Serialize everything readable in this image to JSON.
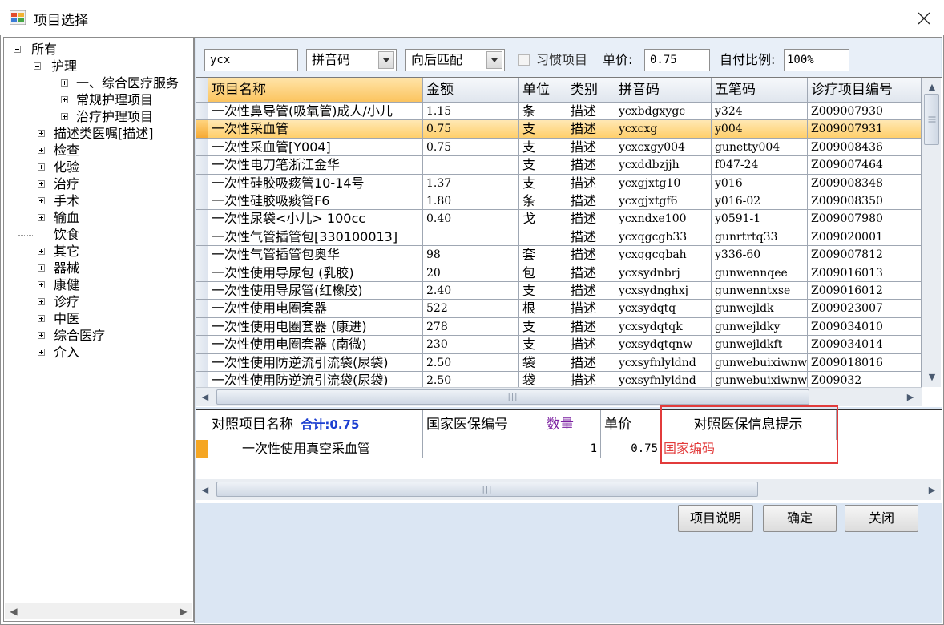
{
  "window": {
    "title": "项目选择",
    "close_glyph": "✕"
  },
  "tree": {
    "root": "所有",
    "nursing": "护理",
    "nursing_children": [
      "一、综合医疗服务",
      "常规护理项目",
      "治疗护理项目"
    ],
    "categories": [
      "描述类医嘱[描述]",
      "检查",
      "化验",
      "治疗",
      "手术",
      "输血",
      "饮食",
      "其它",
      "器械",
      "康健",
      "诊疗",
      "中医",
      "综合医疗",
      "介入"
    ]
  },
  "search": {
    "query": "ycx",
    "mode": "拼音码",
    "match": "向后匹配",
    "habit_label": "习惯项目",
    "habit_checked": false,
    "price_label": "单价:",
    "price_value": "0.75",
    "ratio_label": "自付比例:",
    "ratio_value": "100%"
  },
  "grid": {
    "columns": [
      "项目名称",
      "金额",
      "单位",
      "类别",
      "拼音码",
      "五笔码",
      "诊疗项目编号"
    ],
    "selected_index": 1,
    "rows": [
      [
        "一次性鼻导管(吸氧管)成人/小儿",
        "1.15",
        "条",
        "描述",
        "ycxbdgxygc",
        "y324",
        "Z009007930"
      ],
      [
        "一次性采血管",
        "0.75",
        "支",
        "描述",
        "ycxcxg",
        "y004",
        "Z009007931"
      ],
      [
        "一次性采血管[Y004]",
        "0.75",
        "支",
        "描述",
        "ycxcxgy004",
        "gunetty004",
        "Z009008436"
      ],
      [
        "一次性电刀笔浙江金华",
        "",
        "支",
        "描述",
        "ycxddbzjjh",
        "f047-24",
        "Z009007464"
      ],
      [
        "一次性硅胶吸痰管10-14号",
        "1.37",
        "支",
        "描述",
        "ycxgjxtg10",
        "y016",
        "Z009008348"
      ],
      [
        "一次性硅胶吸痰管F6",
        "1.80",
        "条",
        "描述",
        "ycxgjxtgf6",
        "y016-02",
        "Z009008350"
      ],
      [
        "一次性尿袋<小儿> 100cc",
        "0.40",
        "戈",
        "描述",
        "ycxndxe100",
        "y0591-1",
        "Z009007980"
      ],
      [
        "一次性气管插管包[330100013]",
        "",
        "",
        "描述",
        "ycxqgcgb33",
        "gunrtrtq33",
        "Z009020001"
      ],
      [
        "一次性气管插管包奥华",
        "98",
        "套",
        "描述",
        "ycxqgcgbah",
        "y336-60",
        "Z009007812"
      ],
      [
        "一次性使用导尿包 (乳胶)",
        "20",
        "包",
        "描述",
        "ycxsydnbrj",
        "gunwennqee",
        "Z009016013"
      ],
      [
        "一次性使用导尿管(红橡胶)",
        "2.40",
        "支",
        "描述",
        "ycxsydnghxj",
        "gunwenntxse",
        "Z009016012"
      ],
      [
        "一次性使用电圈套器",
        "522",
        "根",
        "描述",
        "ycxsydqtq",
        "gunwejldk",
        "Z009023007"
      ],
      [
        "一次性使用电圈套器 (康进)",
        "278",
        "支",
        "描述",
        "ycxsydqtqk",
        "gunwejldky",
        "Z009034010"
      ],
      [
        "一次性使用电圈套器 (南微)",
        "230",
        "支",
        "描述",
        "ycxsydqtqnw",
        "gunwejldkft",
        "Z009034014"
      ],
      [
        "一次性使用防逆流引流袋(尿袋)",
        "2.50",
        "袋",
        "描述",
        "ycxsyfnlyldnd",
        "gunwebuixiwnw",
        "Z009018016"
      ],
      [
        "一次性使用防逆流引流袋(尿袋)",
        "2.50",
        "袋",
        "描述",
        "ycxsyfnlyldnd",
        "gunwebuixiwnw",
        "Z009032"
      ]
    ]
  },
  "detail": {
    "col_name": "对照项目名称",
    "total_label": "合计:0.75",
    "col_code": "国家医保编号",
    "col_qty": "数量",
    "col_price": "单价",
    "col_hint": "对照医保信息提示",
    "row": {
      "name": "一次性使用真空采血管",
      "code": "",
      "qty": "1",
      "price": "0.75",
      "hint": "国家编码"
    }
  },
  "buttons": {
    "desc": "项目说明",
    "ok": "确定",
    "close": "关闭"
  },
  "colors": {
    "selected_row": "#ffcf6b",
    "hint_red": "#e23b3b",
    "total_blue": "#1d3fd1",
    "qty_purple": "#7a1fa0"
  }
}
